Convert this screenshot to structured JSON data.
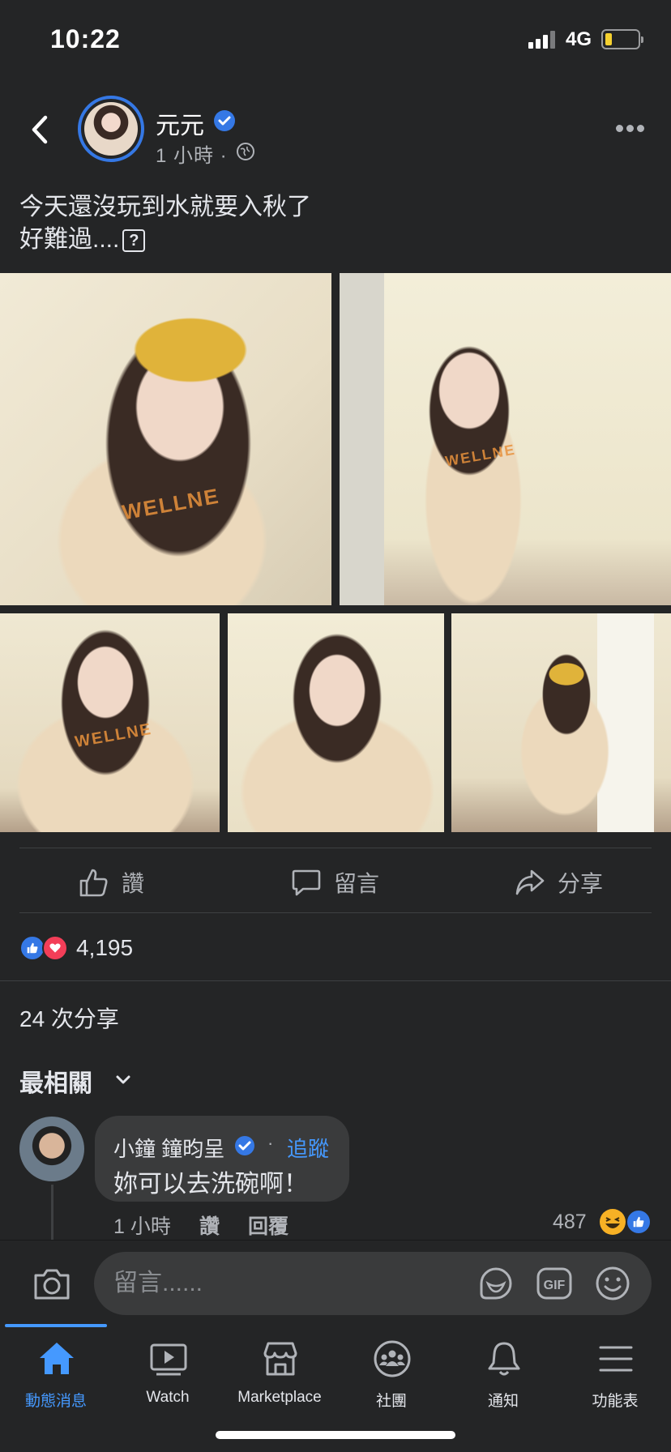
{
  "status_bar": {
    "time": "10:22",
    "network": "4G"
  },
  "post": {
    "author": "元元",
    "time": "1 小時 ·",
    "text_line1": "今天還沒玩到水就要入秋了",
    "text_line2": "好難過....",
    "photo_tags": [
      "WELLNE",
      "WELLNE",
      "WELLNE"
    ]
  },
  "actions": {
    "like": "讚",
    "comment": "留言",
    "share": "分享"
  },
  "reactions": {
    "count": "4,195"
  },
  "shares": "24 次分享",
  "sort_label": "最相關",
  "comment": {
    "author": "小鐘 鐘昀呈",
    "dot": "·",
    "follow": "追蹤",
    "text": "妳可以去洗碗啊！",
    "time": "1 小時",
    "like": "讚",
    "reply": "回覆",
    "reaction_count": "487"
  },
  "composer": {
    "placeholder": "留言......"
  },
  "tabs": [
    {
      "label": "動態消息",
      "icon": "home-icon",
      "active": true
    },
    {
      "label": "Watch",
      "icon": "watch-icon",
      "active": false
    },
    {
      "label": "Marketplace",
      "icon": "marketplace-icon",
      "active": false
    },
    {
      "label": "社團",
      "icon": "groups-icon",
      "active": false
    },
    {
      "label": "通知",
      "icon": "bell-icon",
      "active": false
    },
    {
      "label": "功能表",
      "icon": "menu-icon",
      "active": false
    }
  ],
  "colors": {
    "accent": "#4599ff",
    "like_blue": "#3578e5",
    "heart_red": "#f33e58",
    "background": "#242526"
  }
}
